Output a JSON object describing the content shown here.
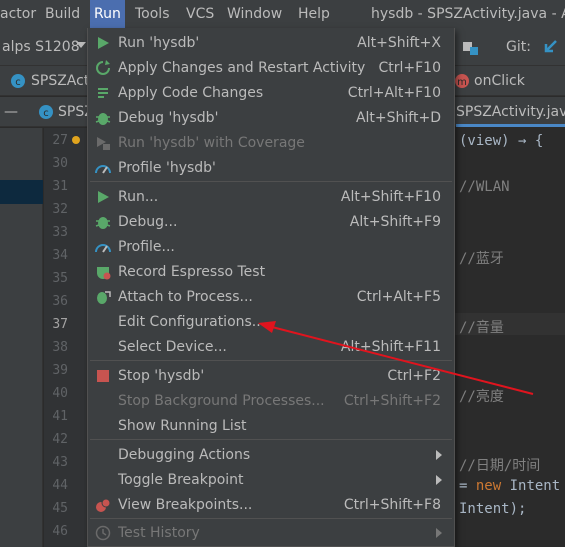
{
  "menubar": {
    "items": [
      "actor",
      "Build",
      "Run",
      "Tools",
      "VCS",
      "Window",
      "Help"
    ],
    "window_title": "hysdb - SPSZActivity.java - Ar"
  },
  "toolbar": {
    "device": "alps S1208",
    "git_label": "Git:"
  },
  "tabs": {
    "left_tab": "SPSZAct",
    "left_tab2": "SPSZActi",
    "right_tab": "onClick",
    "file_tab": "SPSZActivity.java",
    "project_s": "S"
  },
  "gutter": {
    "lines": [
      "27",
      "30",
      "31",
      "32",
      "33",
      "34",
      "35",
      "36",
      "37",
      "38",
      "39",
      "40",
      "41",
      "42",
      "43",
      "44",
      "45",
      "46"
    ]
  },
  "code": {
    "l27": "(view) → {",
    "l31": "//WLAN",
    "l34": "//蓝牙",
    "l37": "//音量",
    "l40": "//亮度",
    "l43": "//日期/时间",
    "l44_a": "= ",
    "l44_kw": "new",
    "l44_b": " Intent",
    "l45": "Intent);"
  },
  "run_menu": {
    "items": [
      {
        "label": "Run 'hysdb'",
        "shortcut": "Alt+Shift+X",
        "icon": "run-icon",
        "disabled": false
      },
      {
        "label": "Apply Changes and Restart Activity",
        "shortcut": "Ctrl+F10",
        "icon": "apply-changes-icon",
        "disabled": false
      },
      {
        "label": "Apply Code Changes",
        "shortcut": "Ctrl+Alt+F10",
        "icon": "apply-code-icon",
        "disabled": false
      },
      {
        "label": "Debug 'hysdb'",
        "shortcut": "Alt+Shift+D",
        "icon": "debug-icon",
        "disabled": false
      },
      {
        "label": "Run 'hysdb' with Coverage",
        "shortcut": "",
        "icon": "coverage-icon",
        "disabled": true
      },
      {
        "label": "Profile 'hysdb'",
        "shortcut": "",
        "icon": "profile-icon",
        "disabled": false
      },
      {
        "label": "Run...",
        "shortcut": "Alt+Shift+F10",
        "icon": "run-icon",
        "disabled": false
      },
      {
        "label": "Debug...",
        "shortcut": "Alt+Shift+F9",
        "icon": "debug-icon",
        "disabled": false
      },
      {
        "label": "Profile...",
        "shortcut": "",
        "icon": "profile-icon",
        "disabled": false
      },
      {
        "label": "Record Espresso Test",
        "shortcut": "",
        "icon": "espresso-icon",
        "disabled": false
      },
      {
        "label": "Attach to Process...",
        "shortcut": "Ctrl+Alt+F5",
        "icon": "attach-debugger-icon",
        "disabled": false
      },
      {
        "label": "Edit Configurations...",
        "shortcut": "",
        "icon": "",
        "disabled": false
      },
      {
        "label": "Select Device...",
        "shortcut": "Alt+Shift+F11",
        "icon": "",
        "disabled": false
      },
      {
        "label": "Stop 'hysdb'",
        "shortcut": "Ctrl+F2",
        "icon": "stop-icon",
        "disabled": false
      },
      {
        "label": "Stop Background Processes...",
        "shortcut": "Ctrl+Shift+F2",
        "icon": "",
        "disabled": true
      },
      {
        "label": "Show Running List",
        "shortcut": "",
        "icon": "",
        "disabled": false
      },
      {
        "label": "Debugging Actions",
        "shortcut": "",
        "icon": "",
        "disabled": false,
        "submenu": true
      },
      {
        "label": "Toggle Breakpoint",
        "shortcut": "",
        "icon": "",
        "disabled": false,
        "submenu": true
      },
      {
        "label": "View Breakpoints...",
        "shortcut": "Ctrl+Shift+F8",
        "icon": "breakpoints-icon",
        "disabled": false
      },
      {
        "label": "Test History",
        "shortcut": "",
        "icon": "history-icon",
        "disabled": true,
        "submenu": true
      }
    ]
  },
  "colors": {
    "menu_active": "#4b6eaf",
    "annotation_arrow": "#e0141e"
  }
}
